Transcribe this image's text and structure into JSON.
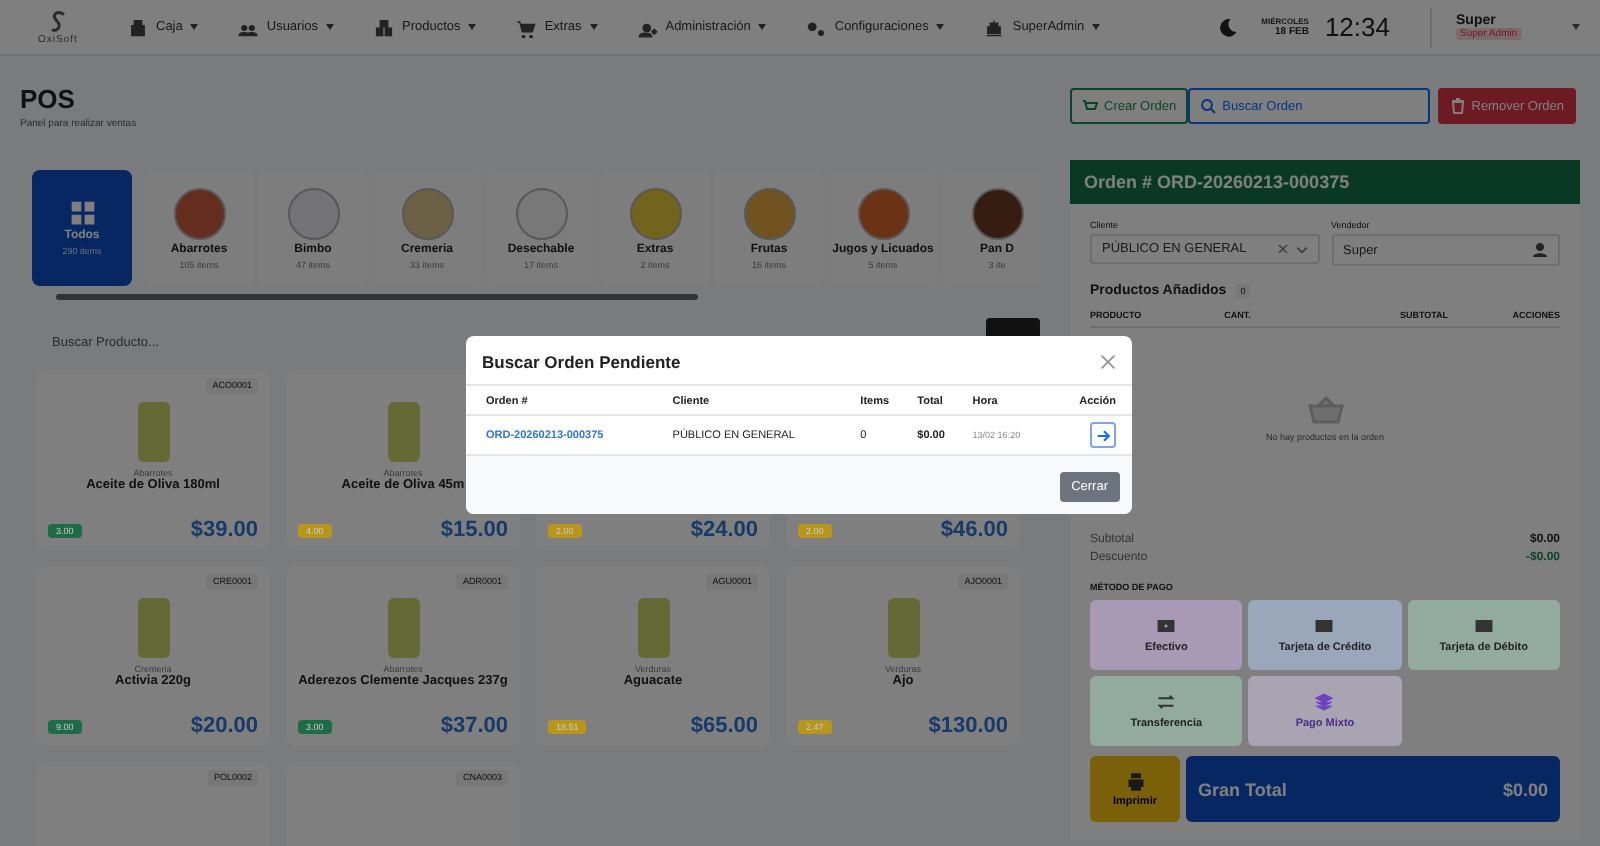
{
  "nav": {
    "logo": "OxiSoft",
    "menus": [
      {
        "label": "Caja"
      },
      {
        "label": "Usuarios"
      },
      {
        "label": "Productos"
      },
      {
        "label": "Extras"
      },
      {
        "label": "Administración"
      },
      {
        "label": "Configuraciones"
      },
      {
        "label": "SuperAdmin"
      }
    ],
    "clock": {
      "day": "MIÉRCOLES",
      "date": "18 FEB",
      "time": "12:34"
    },
    "user": {
      "name": "Super",
      "role": "Super Admin"
    }
  },
  "page": {
    "title": "POS",
    "subtitle": "Panel para realizar ventas"
  },
  "actions": [
    {
      "label": "Crear Orden",
      "kind": "create"
    },
    {
      "label": "Buscar Orden",
      "kind": "search"
    },
    {
      "label": "Remover Orden",
      "kind": "remove"
    }
  ],
  "categories": [
    {
      "name": "Todos",
      "count": "290 items",
      "selected": true
    },
    {
      "name": "Abarrotes",
      "count": "105 items",
      "selected": false
    },
    {
      "name": "Bimbo",
      "count": "47 items",
      "selected": false
    },
    {
      "name": "Cremeria",
      "count": "33 items",
      "selected": false
    },
    {
      "name": "Desechable",
      "count": "17 items",
      "selected": false
    },
    {
      "name": "Extras",
      "count": "2 items",
      "selected": false
    },
    {
      "name": "Frutas",
      "count": "16 items",
      "selected": false
    },
    {
      "name": "Jugos y Licuados",
      "count": "5 items",
      "selected": false
    },
    {
      "name": "Pan D",
      "count": "3 ite",
      "selected": false
    }
  ],
  "search": {
    "placeholder": "Buscar Producto..."
  },
  "products": [
    {
      "code": "ACO0001",
      "category": "Abarrotes",
      "name": "Aceite de Oliva 180ml",
      "stock": "3.00",
      "color": "#1e6b47",
      "price": "$39.00"
    },
    {
      "category": "Abarrotes",
      "name": "Aceite de Oliva 45m",
      "stock": "4.00",
      "color": "#b8961c",
      "price": "$15.00"
    },
    {
      "stock": "2.00",
      "color": "#b8961c",
      "price": "$24.00"
    },
    {
      "stock": "2.00",
      "color": "#b8961c",
      "price": "$46.00"
    },
    {
      "code": "CRE0001",
      "category": "Cremeria",
      "name": "Activia 220g",
      "stock": "9.00",
      "color": "#1e6b47",
      "price": "$20.00"
    },
    {
      "code": "ADR0001",
      "category": "Abarrotes",
      "name": "Aderezos Clemente Jacques 237g",
      "stock": "3.00",
      "color": "#1e6b47",
      "price": "$37.00"
    },
    {
      "code": "AGU0001",
      "category": "Verduras",
      "name": "Aguacate",
      "stock": "18.51",
      "color": "#b8961c",
      "price": "$65.00"
    },
    {
      "code": "AJO0001",
      "category": "Verduras",
      "name": "Ajo",
      "stock": "2.47",
      "color": "#b8961c",
      "price": "$130.00"
    },
    {
      "code": "POL0002"
    },
    {
      "code": "CNA0003"
    }
  ],
  "order": {
    "title": "Orden # ORD-20260213-000375",
    "client_label": "Cliente",
    "client": "PÚBLICO EN GENERAL",
    "seller_label": "Vendedor",
    "seller": "Super",
    "added_title": "Productos Añadidos",
    "added_count": "0",
    "columns": [
      "PRODUCTO",
      "CANT.",
      "SUBTOTAL",
      "ACCIONES"
    ],
    "empty": "No hay productos en la orden",
    "totals": [
      {
        "label": "Subtotal",
        "value": "$0.00",
        "kind": "plain"
      },
      {
        "label": "Descuento",
        "value": "-$0.00",
        "kind": "discount"
      }
    ],
    "payment_title": "MÉTODO DE PAGO",
    "payments": [
      {
        "label": "Efectivo",
        "kind": "cash",
        "color": "#a899b5"
      },
      {
        "label": "Tarjeta de Crédito",
        "kind": "card",
        "color": "#9aa7bb"
      },
      {
        "label": "Tarjeta de Débito",
        "kind": "card",
        "color": "#93aa9f"
      },
      {
        "label": "Transferencia",
        "kind": "transfer",
        "color": "#93aa9f"
      },
      {
        "label": "Pago Mixto",
        "kind": "mixed",
        "color": "#a9a4b2"
      }
    ],
    "print": "Imprimir",
    "grand_label": "Gran Total",
    "grand_value": "$0.00"
  },
  "modal": {
    "title": "Buscar Orden Pendiente",
    "columns": [
      "Orden #",
      "Cliente",
      "Items",
      "Total",
      "Hora",
      "Acción"
    ],
    "rows": [
      {
        "order": "ORD-20260213-000375",
        "client": "PÚBLICO EN GENERAL",
        "items": "0",
        "total": "$0.00",
        "time": "13/02 16:20"
      }
    ],
    "close": "Cerrar"
  }
}
